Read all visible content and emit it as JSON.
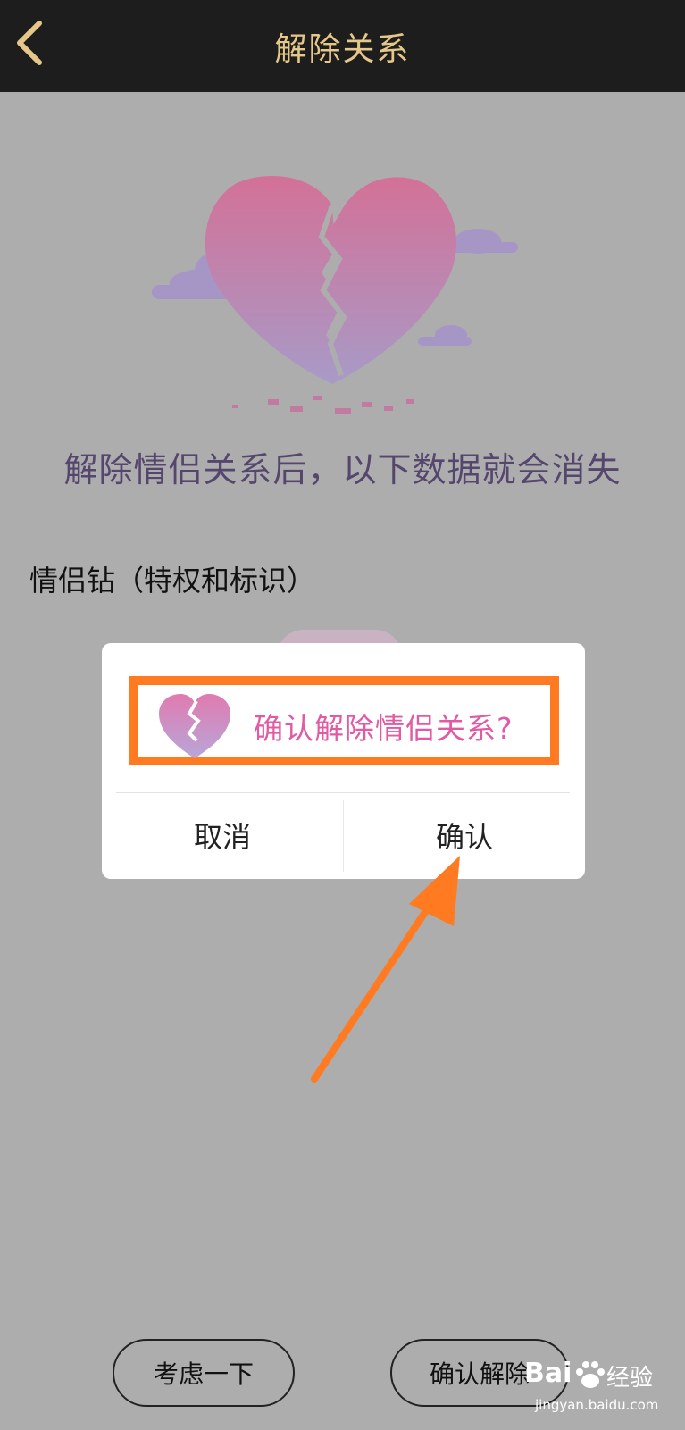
{
  "header": {
    "back_icon": "chevron-left-icon",
    "title": "解除关系"
  },
  "main": {
    "hero_icon": "broken-heart-icon",
    "headline": "解除情侣关系后，以下数据就会消失",
    "items": [
      {
        "label": "情侣钻（特权和标识）"
      }
    ]
  },
  "dialog": {
    "icon": "broken-heart-icon",
    "message": "确认解除情侣关系?",
    "cancel_label": "取消",
    "confirm_label": "确认",
    "highlight_color": "#ff7a21"
  },
  "footer": {
    "think_label": "考虑一下",
    "confirm_label": "确认解除"
  },
  "watermark": {
    "brand": "Bai",
    "brand2": "经验",
    "url": "jingyan.baidu.com"
  },
  "colors": {
    "header_bg": "#1d1d1d",
    "header_text": "#e6c78a",
    "overlay_bg": "#adadad",
    "dialog_text": "#e25aa3",
    "annotation": "#ff7a21"
  }
}
